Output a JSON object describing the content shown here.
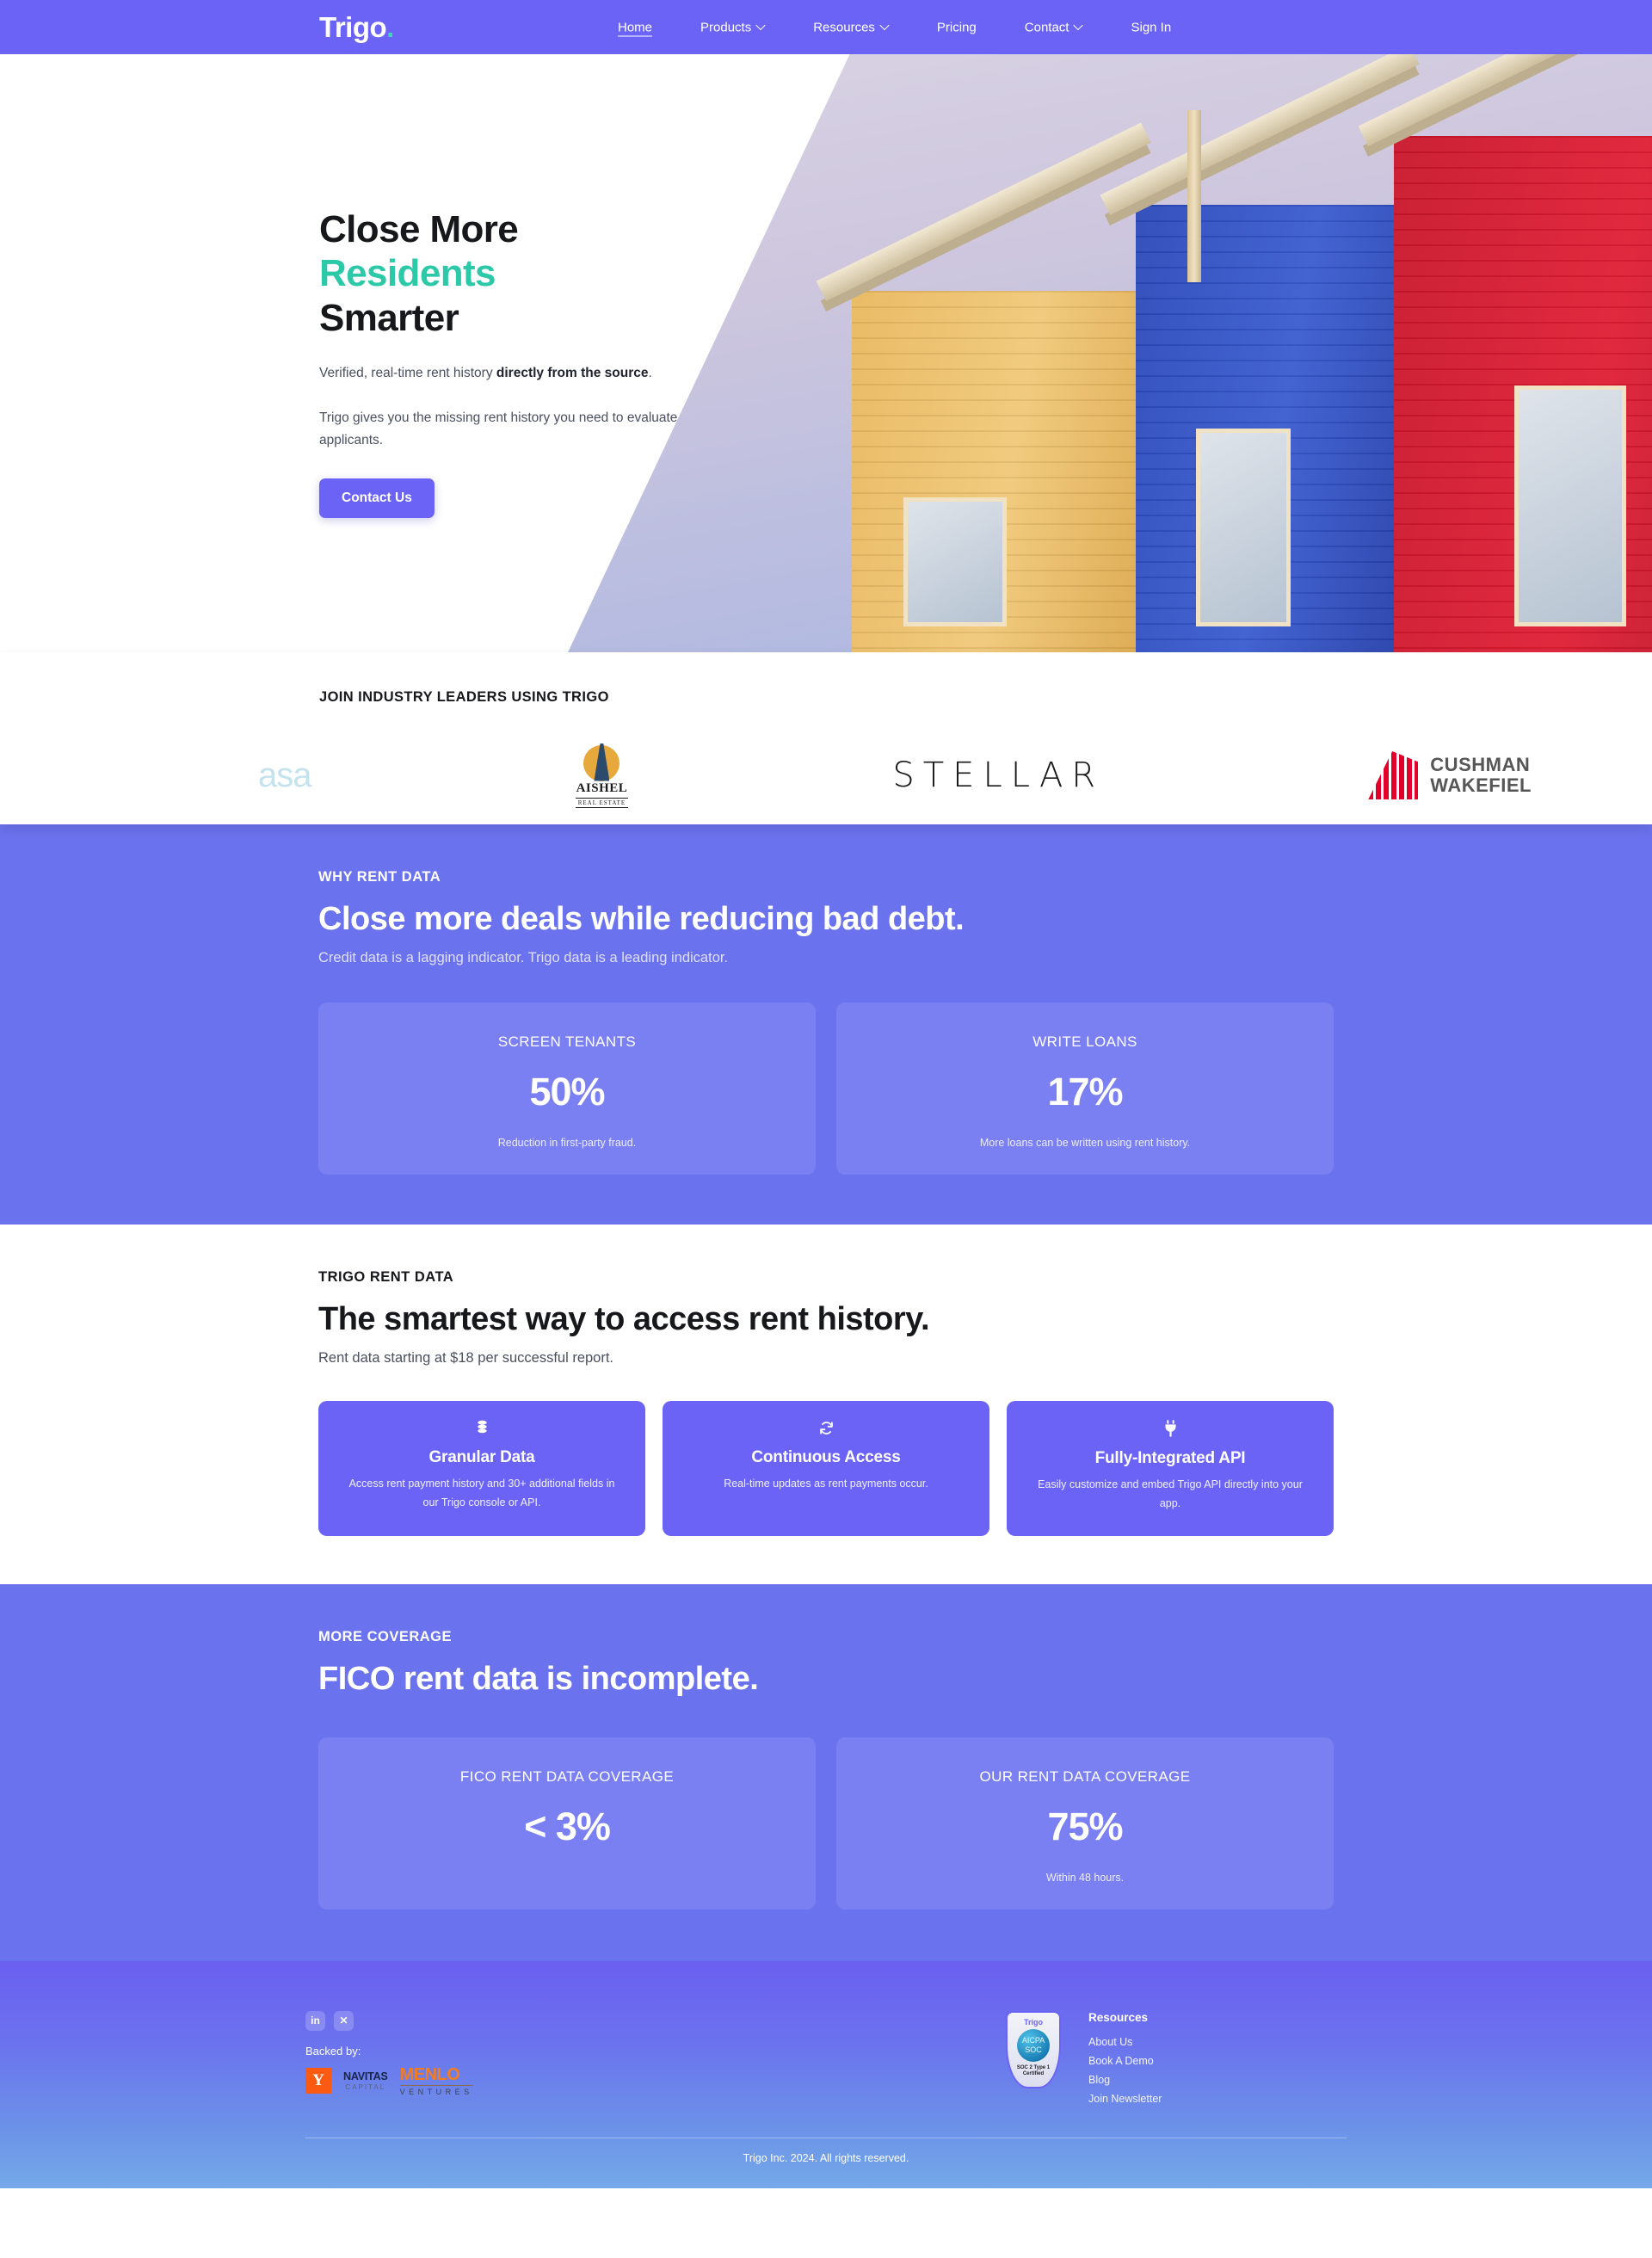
{
  "brand": {
    "logo_text": "Trigo",
    "logo_dot": ".",
    "purple": "#6B63F5",
    "purple_section": "#6B72EE",
    "teal": "#2CC9A8"
  },
  "nav": {
    "items": [
      {
        "label": "Home",
        "caret": false,
        "active": true
      },
      {
        "label": "Products",
        "caret": true,
        "active": false
      },
      {
        "label": "Resources",
        "caret": true,
        "active": false
      },
      {
        "label": "Pricing",
        "caret": false,
        "active": false
      },
      {
        "label": "Contact",
        "caret": true,
        "active": false
      },
      {
        "label": "Sign In",
        "caret": false,
        "active": false
      }
    ]
  },
  "hero": {
    "line1": "Close More",
    "line2": "Residents",
    "line3": "Smarter",
    "para1_plain": "Verified, real-time rent history ",
    "para1_bold": "directly from the source",
    "para1_tail": ".",
    "para2": "Trigo gives you the missing rent history you need to evaluate applicants.",
    "cta": "Contact Us"
  },
  "logos": {
    "title": "JOIN INDUSTRY LEADERS USING TRIGO",
    "items": [
      {
        "name": "asa",
        "text": "asa"
      },
      {
        "name": "aishel",
        "text": "AISHEL",
        "sub": "REAL ESTATE"
      },
      {
        "name": "stellar",
        "text": "STELLAR"
      },
      {
        "name": "cushman-wakefield",
        "text": "CUSHMAN",
        "text2": "WAKEFIEL"
      }
    ]
  },
  "why_rent_data": {
    "eyebrow": "WHY RENT DATA",
    "headline": "Close more deals while reducing bad debt.",
    "subline": "Credit data is a lagging indicator. Trigo data is a leading indicator.",
    "cards": [
      {
        "label": "SCREEN TENANTS",
        "value": "50%",
        "desc": "Reduction in first-party fraud."
      },
      {
        "label": "WRITE LOANS",
        "value": "17%",
        "desc": "More loans can be written using rent history."
      }
    ]
  },
  "trigo_rent_data": {
    "eyebrow": "TRIGO RENT DATA",
    "headline": "The smartest way to access rent history.",
    "subline": "Rent data starting at $18 per successful report.",
    "cards": [
      {
        "icon": "database-icon",
        "glyph": "⛃",
        "title": "Granular Data",
        "desc": "Access rent payment history and 30+ additional fields in our Trigo console or API."
      },
      {
        "icon": "refresh-icon",
        "glyph": "↻",
        "title": "Continuous Access",
        "desc": "Real-time updates as rent payments occur."
      },
      {
        "icon": "plug-icon",
        "glyph": "⚡",
        "title": "Fully-Integrated API",
        "desc": "Easily customize and embed Trigo API directly into your app."
      }
    ]
  },
  "more_coverage": {
    "eyebrow": "MORE COVERAGE",
    "headline": "FICO rent data is incomplete.",
    "cards": [
      {
        "label": "FICO RENT DATA COVERAGE",
        "value": "< 3%",
        "desc": ""
      },
      {
        "label": "OUR RENT DATA COVERAGE",
        "value": "75%",
        "desc": "Within 48 hours."
      }
    ]
  },
  "footer": {
    "social": [
      {
        "name": "linkedin-icon",
        "glyph": "in"
      },
      {
        "name": "x-twitter-icon",
        "glyph": "✕"
      }
    ],
    "backed_label": "Backed by:",
    "investors": [
      {
        "name": "ycombinator",
        "text": "Y"
      },
      {
        "name": "navitas-capital",
        "line1": "NAVITAS",
        "line2": "CAPITAL"
      },
      {
        "name": "menlo-ventures",
        "line1": "MENLO",
        "line2": "VENTURES"
      }
    ],
    "soc2_badge": {
      "brand": "Trigo",
      "line1": "AICPA",
      "line2": "SOC",
      "cert": "SOC 2 Type 1 Certified"
    },
    "links_title": "Resources",
    "links": [
      {
        "label": "About Us"
      },
      {
        "label": "Book A Demo"
      },
      {
        "label": "Blog"
      },
      {
        "label": "Join Newsletter"
      }
    ],
    "copyright": "Trigo Inc. 2024. All rights reserved."
  }
}
